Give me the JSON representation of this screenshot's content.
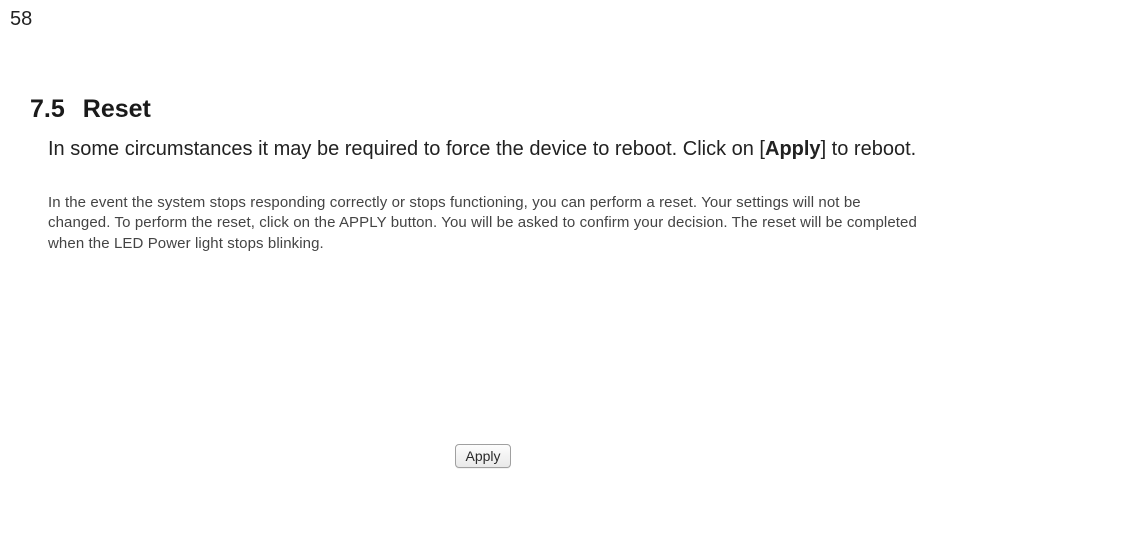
{
  "page_number": "58",
  "section": {
    "number": "7.5",
    "title": "Reset"
  },
  "body": {
    "prefix": "In some circumstances it may be required to force the device to reboot. Click on [",
    "bold": "Apply",
    "suffix": "] to reboot."
  },
  "panel": {
    "text": "In the event the system stops responding correctly or stops functioning, you can perform a reset. Your settings will not be changed. To perform the reset, click on the APPLY button. You will be asked to confirm your decision. The reset will be completed when the LED Power light stops blinking."
  },
  "button": {
    "apply_label": "Apply"
  }
}
